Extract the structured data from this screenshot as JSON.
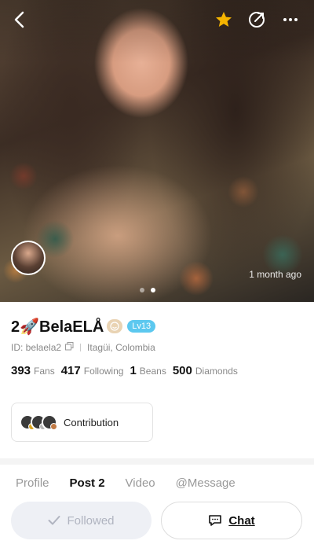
{
  "hero": {
    "time_label": "1 month ago",
    "dots_count": 2,
    "active_dot": 1
  },
  "profile": {
    "name": "2🚀BelaELÅ",
    "level": "Lv13",
    "id_text": "ID: belaela2",
    "location": "Itagüi, Colombia",
    "stats": [
      {
        "value": "393",
        "label": "Fans"
      },
      {
        "value": "417",
        "label": "Following"
      },
      {
        "value": "1",
        "label": "Beans"
      },
      {
        "value": "500",
        "label": "Diamonds"
      }
    ],
    "contribution_label": "Contribution"
  },
  "tabs": [
    "Profile",
    "Post 2",
    "Video",
    "@Message"
  ],
  "active_tab": 1,
  "actions": {
    "followed_label": "Followed",
    "chat_label": "Chat"
  },
  "colors": {
    "star": "#f5b400",
    "level_badge": "#5cc8ef",
    "followed_bg": "#eef0f5"
  },
  "icons": {
    "back": "chevron-left-icon",
    "favorite": "star-icon",
    "share": "share-icon",
    "more": "more-icon",
    "copy": "copy-icon",
    "check": "check-icon",
    "chat": "chat-bubble-icon"
  }
}
